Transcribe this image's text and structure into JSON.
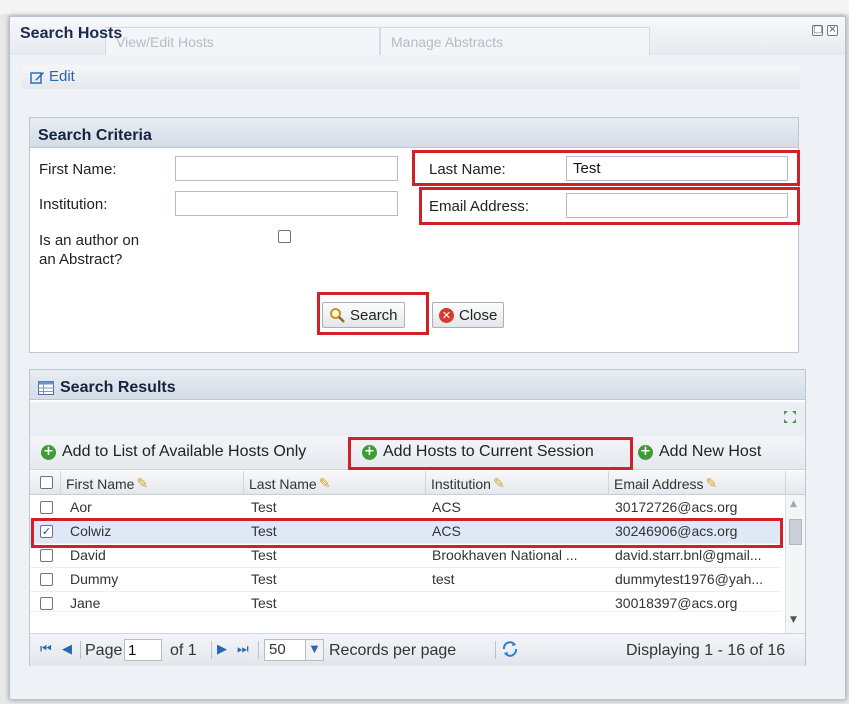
{
  "window": {
    "title": "Search Hosts",
    "behind_tabs": [
      "View/Edit Hosts",
      "Manage Abstracts"
    ]
  },
  "edit_label": "Edit",
  "search_criteria": {
    "heading": "Search Criteria",
    "first_name_label": "First Name:",
    "first_name_value": "",
    "last_name_label": "Last Name:",
    "last_name_value": "Test",
    "institution_label": "Institution:",
    "institution_value": "",
    "email_label": "Email Address:",
    "email_value": "",
    "author_label_line1": "Is an author on",
    "author_label_line2": "an Abstract?",
    "author_checked": false,
    "search_button": "Search",
    "close_button": "Close"
  },
  "search_results": {
    "heading": "Search Results",
    "actions": [
      "Add to List of Available Hosts Only",
      "Add Hosts to Current Session",
      "Add New Host"
    ],
    "columns": [
      "First Name",
      "Last Name",
      "Institution",
      "Email Address"
    ],
    "rows": [
      {
        "first": "Aor",
        "last": "Test",
        "institution": "ACS",
        "email": "30172726@acs.org",
        "checked": false
      },
      {
        "first": "Colwiz",
        "last": "Test",
        "institution": "ACS",
        "email": "30246906@acs.org",
        "checked": true
      },
      {
        "first": "David",
        "last": "Test",
        "institution": "Brookhaven National ...",
        "email": "david.starr.bnl@gmail...",
        "checked": false
      },
      {
        "first": "Dummy",
        "last": "Test",
        "institution": "test",
        "email": "dummytest1976@yah...",
        "checked": false
      },
      {
        "first": "Jane",
        "last": "Test",
        "institution": "",
        "email": "30018397@acs.org",
        "checked": false
      }
    ]
  },
  "pager": {
    "page_label": "Page",
    "page_value": "1",
    "of_label": "of 1",
    "per_page_value": "50",
    "per_page_label": "Records per page",
    "display_text": "Displaying 1 - 16 of 16"
  },
  "colors": {
    "highlight": "#d0212b",
    "link": "#2466b5",
    "selected_row": "#dfe8f6"
  }
}
